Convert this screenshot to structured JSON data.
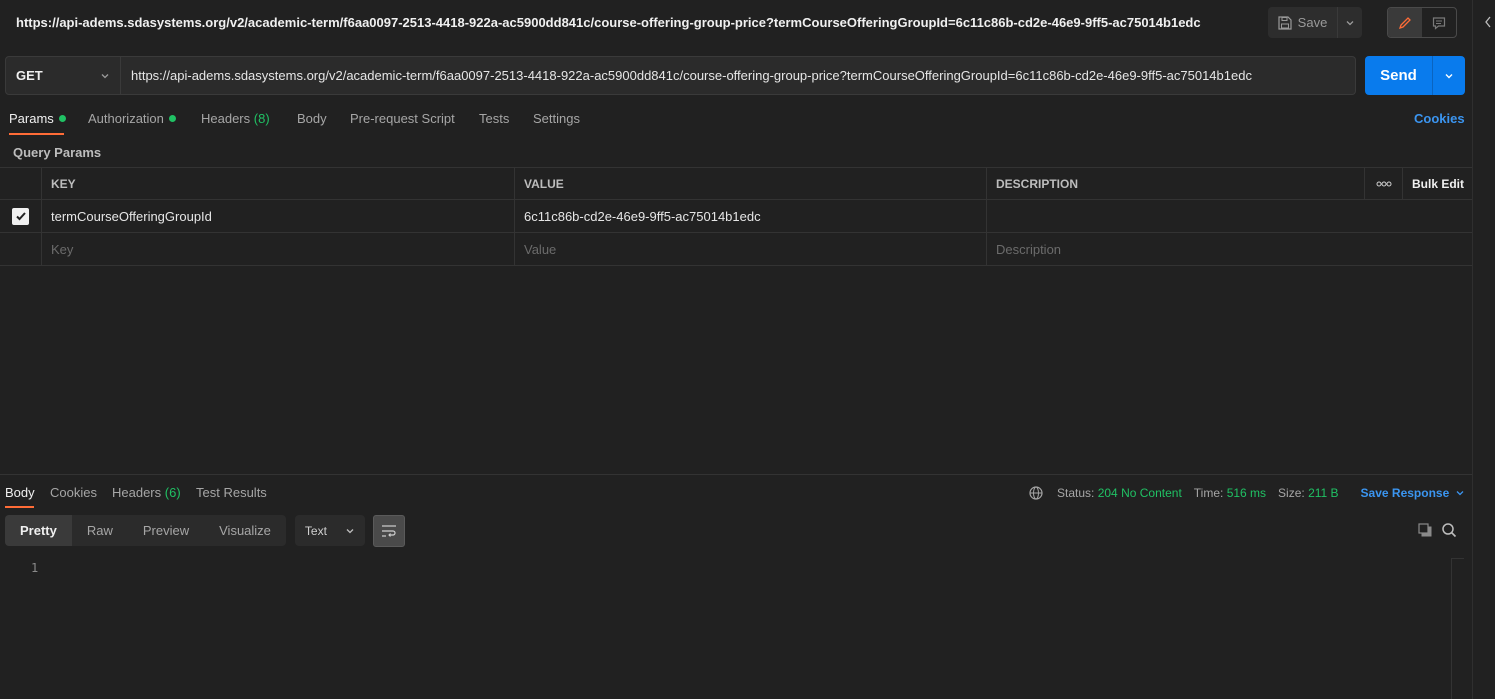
{
  "title": {
    "url": "https://api-adems.sdasystems.org/v2/academic-term/f6aa0097-2513-4418-922a-ac5900dd841c/course-offering-group-price?termCourseOfferingGroupId=6c11c86b-cd2e-46e9-9ff5-ac75014b1edc",
    "save_label": "Save"
  },
  "request": {
    "method": "GET",
    "url": "https://api-adems.sdasystems.org/v2/academic-term/f6aa0097-2513-4418-922a-ac5900dd841c/course-offering-group-price?termCourseOfferingGroupId=6c11c86b-cd2e-46e9-9ff5-ac75014b1edc",
    "send_label": "Send"
  },
  "request_tabs": {
    "params": "Params",
    "authorization": "Authorization",
    "headers": "Headers",
    "headers_count": "(8)",
    "body": "Body",
    "prerequest": "Pre-request Script",
    "tests": "Tests",
    "settings": "Settings",
    "cookies": "Cookies"
  },
  "query_params": {
    "label": "Query Params",
    "columns": {
      "key": "KEY",
      "value": "VALUE",
      "description": "DESCRIPTION",
      "bulk_edit": "Bulk Edit"
    },
    "rows": [
      {
        "key": "termCourseOfferingGroupId",
        "value": "6c11c86b-cd2e-46e9-9ff5-ac75014b1edc",
        "description": "",
        "checked": true
      }
    ],
    "placeholders": {
      "key": "Key",
      "value": "Value",
      "description": "Description"
    }
  },
  "response_tabs": {
    "body": "Body",
    "cookies": "Cookies",
    "headers": "Headers",
    "headers_count": "(6)",
    "test_results": "Test Results"
  },
  "response_meta": {
    "status_label": "Status:",
    "status_code": "204",
    "status_text": "No Content",
    "time_label": "Time:",
    "time_value": "516 ms",
    "size_label": "Size:",
    "size_value": "211 B",
    "save_response": "Save Response"
  },
  "response_view": {
    "pretty": "Pretty",
    "raw": "Raw",
    "preview": "Preview",
    "visualize": "Visualize",
    "format": "Text",
    "line_number": "1"
  },
  "colors": {
    "accent_blue": "#097bed",
    "active_tab_orange": "#ff6c37",
    "status_green": "#20c164",
    "link_blue": "#3b95f0"
  }
}
